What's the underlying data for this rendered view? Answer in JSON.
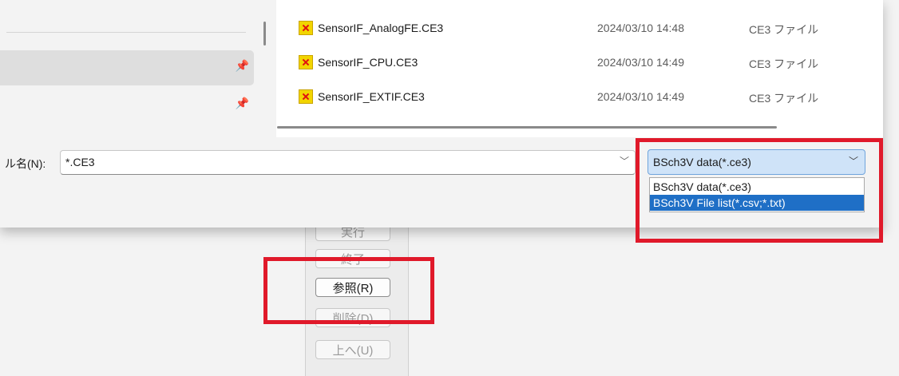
{
  "app": {
    "buttons": [
      {
        "label": "実行",
        "state": "disabled"
      },
      {
        "label": "終了",
        "state": "disabled"
      },
      {
        "label": "参照(R)",
        "state": "enabled"
      },
      {
        "label": "削除(D)",
        "state": "disabled"
      },
      {
        "label": "上へ(U)",
        "state": "disabled"
      }
    ]
  },
  "dialog": {
    "files": [
      {
        "name": "SensorIF_AnalogFE.CE3",
        "date": "2024/03/10 14:48",
        "type": "CE3 ファイル"
      },
      {
        "name": "SensorIF_CPU.CE3",
        "date": "2024/03/10 14:49",
        "type": "CE3 ファイル"
      },
      {
        "name": "SensorIF_EXTIF.CE3",
        "date": "2024/03/10 14:49",
        "type": "CE3 ファイル"
      }
    ],
    "filename_label": "ル名(N):",
    "filename_value": "*.CE3",
    "filter_selected": "BSch3V data(*.ce3)",
    "filter_options": [
      "BSch3V data(*.ce3)",
      "BSch3V File list(*.csv;*.txt)"
    ],
    "icons": {
      "pin": "pin-icon",
      "chevron": "chevron-down-icon",
      "file": "ce3-file-icon"
    }
  },
  "colors": {
    "highlight_box": "#e0192a",
    "selected_option": "#1f6fc6",
    "filter_bg": "#cfe3f8"
  }
}
